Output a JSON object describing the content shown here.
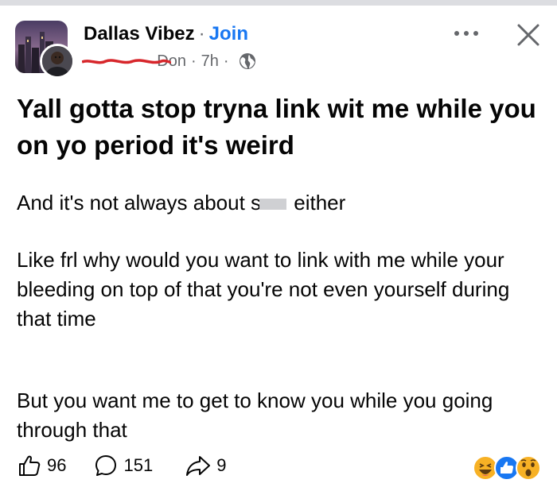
{
  "post": {
    "group_name": "Dallas Vibez",
    "separator": "·",
    "join_label": "Join",
    "author_visible": "Don",
    "time_ago": "7h",
    "meta_separator": "·",
    "headline": "Yall gotta stop tryna link wit me while you on yo period it's weird",
    "paragraph_1_before": "And it's not always about s",
    "paragraph_1_after": " either",
    "paragraph_2": "Like frl why would you want to link with me while your bleeding on top of that you're not even yourself during that time",
    "paragraph_3": "But you want me to get to know you while you going through that"
  },
  "actions": {
    "like_count": "96",
    "comment_count": "151",
    "share_count": "9"
  },
  "icons": {
    "privacy": "globe-icon",
    "more": "more-options-icon",
    "close": "close-icon",
    "like": "thumbs-up-icon",
    "comment": "comment-bubble-icon",
    "share": "share-arrow-icon",
    "reactions": [
      "haha-reaction-icon",
      "like-reaction-icon",
      "wow-reaction-icon"
    ]
  },
  "colors": {
    "link_blue": "#1877f2",
    "secondary_text": "#65676b",
    "redaction_red": "#d7262b",
    "reaction_yellow": "#f7b125"
  }
}
